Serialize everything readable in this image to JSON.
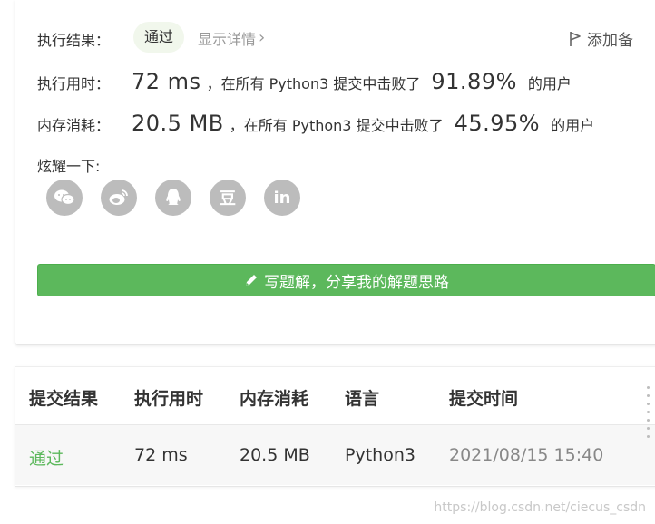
{
  "result": {
    "label": "执行结果：",
    "status": "通过",
    "details_link": "显示详情",
    "details_chevron": "›",
    "add_note": "添加备",
    "add_note_icon": "flag-icon"
  },
  "runtime": {
    "label": "执行用时：",
    "value": "72 ms",
    "mid": "，在所有 Python3 提交中击败了",
    "percent": "91.89%",
    "tail": "的用户"
  },
  "memory": {
    "label": "内存消耗：",
    "value": "20.5 MB",
    "mid": "，在所有 Python3 提交中击败了",
    "percent": "45.95%",
    "tail": "的用户"
  },
  "share": {
    "label": "炫耀一下:",
    "icons": [
      "wechat-icon",
      "weibo-icon",
      "qq-icon",
      "douban-icon",
      "linkedin-icon"
    ],
    "douban_glyph": "豆",
    "linkedin_glyph": "in"
  },
  "write_button": {
    "label": "写题解，分享我的解题思路",
    "icon": "pencil-icon"
  },
  "table": {
    "headers": [
      "提交结果",
      "执行用时",
      "内存消耗",
      "语言",
      "提交时间"
    ],
    "rows": [
      [
        "通过",
        "72 ms",
        "20.5 MB",
        "Python3",
        "2021/08/15 15:40"
      ]
    ]
  },
  "watermark": "https://blog.csdn.net/ciecus_csdn",
  "colors": {
    "accent_green": "#5cb85c",
    "badge_bg": "#f1f7ec",
    "muted_text": "#999999",
    "icon_gray": "#bcbcbc"
  }
}
